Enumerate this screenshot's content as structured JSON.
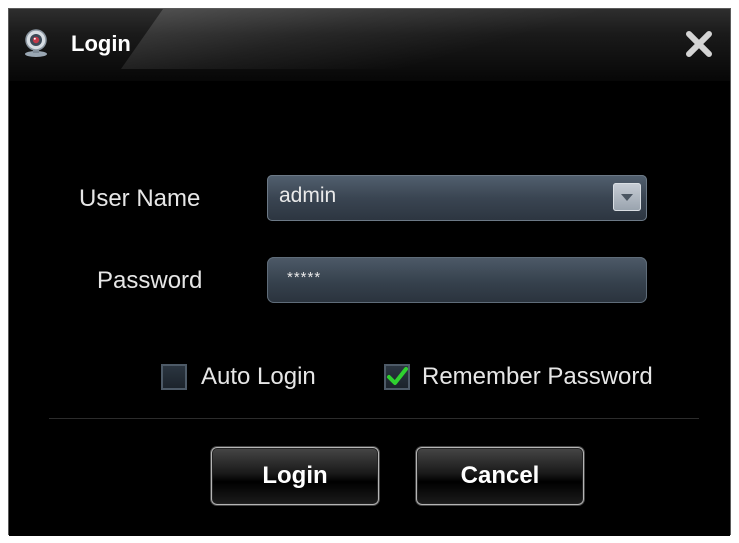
{
  "window": {
    "title": "Login",
    "app_icon": "webcam-icon",
    "close_icon": "close-icon"
  },
  "form": {
    "username_label": "User Name",
    "username_value": "admin",
    "password_label": "Password",
    "password_value": "*****",
    "auto_login_label": "Auto Login",
    "auto_login_checked": false,
    "remember_password_label": "Remember Password",
    "remember_password_checked": true
  },
  "buttons": {
    "login_label": "Login",
    "cancel_label": "Cancel"
  },
  "colors": {
    "background": "#000000",
    "field_fill": "#3a4552",
    "check_mark": "#2fd12f",
    "text": "#e6e6e6"
  }
}
